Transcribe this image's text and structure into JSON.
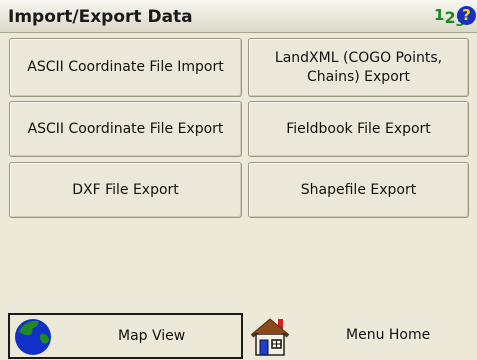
{
  "header": {
    "title": "Import/Export Data",
    "numeric_mode_icon": "numeric-123-icon",
    "help_icon": "help-question-icon"
  },
  "buttons": {
    "ascii_import": "ASCII Coordinate File Import",
    "landxml_line1": "LandXML (COGO Points,",
    "landxml_line2": "Chains) Export",
    "ascii_export": "ASCII Coordinate File Export",
    "fieldbook_export": "Fieldbook File Export",
    "dxf_export": "DXF File Export",
    "shapefile_export": "Shapefile Export"
  },
  "footer": {
    "map_view": "Map View",
    "map_view_icon": "globe-icon",
    "menu_home": "Menu Home",
    "menu_home_icon": "house-icon"
  },
  "colors": {
    "background": "#ece9d8",
    "help_icon_bg": "#1a2fbf",
    "numeric_icon": "#1a8a1a",
    "globe_green": "#1f8a1f",
    "globe_blue": "#1030c8"
  }
}
